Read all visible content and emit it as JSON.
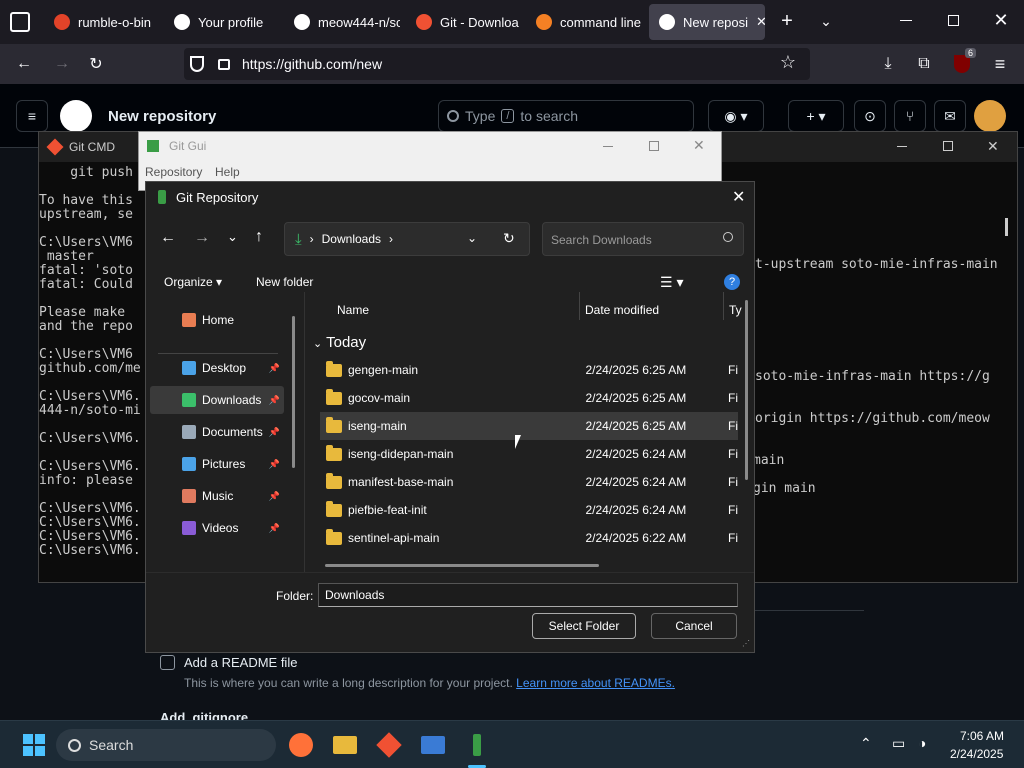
{
  "browser": {
    "tabs": [
      {
        "label": "rumble-o-bin",
        "icon": "gitlab-icon",
        "color": "#e24329"
      },
      {
        "label": "Your profile",
        "icon": "github-icon",
        "color": "#ffffff"
      },
      {
        "label": "meow444-n/sc",
        "icon": "github-icon",
        "color": "#ffffff"
      },
      {
        "label": "Git - Downloa",
        "icon": "git-icon",
        "color": "#f05133"
      },
      {
        "label": "command line",
        "icon": "stackoverflow-icon",
        "color": "#f48024"
      },
      {
        "label": "New reposi",
        "icon": "github-icon",
        "color": "#ffffff"
      }
    ],
    "url": "https://github.com/new",
    "extension_badge": "6"
  },
  "github": {
    "page_title": "New repository",
    "search_prefix": "Type",
    "search_key": "/",
    "search_suffix": "to search",
    "readme_label": "Add a README file",
    "readme_desc": "This is where you can write a long description for your project.",
    "readme_link": "Learn more about READMEs.",
    "gitignore_label": "Add .gitignore"
  },
  "cmd": {
    "title": "Git CMD",
    "lines": [
      "    git push",
      "",
      "To have this",
      "upstream, se",
      "",
      "C:\\Users\\VM6",
      " master",
      "fatal: 'soto",
      "fatal: Could",
      "",
      "Please make",
      "and the repo",
      "",
      "C:\\Users\\VM6",
      "github.com/me",
      "",
      "C:\\Users\\VM6.",
      "444-n/soto-mi",
      "",
      "C:\\Users\\VM6.",
      "",
      "C:\\Users\\VM6.",
      "info: please",
      "",
      "C:\\Users\\VM6.",
      "C:\\Users\\VM6.",
      "C:\\Users\\VM6.",
      "C:\\Users\\VM6."
    ],
    "right_lines": [
      {
        "text": "t-upstream soto-mie-infras-main",
        "row": 8
      },
      {
        "text": "soto-mie-infras-main https://g",
        "row": 11
      },
      {
        "text": "origin https://github.com/meow",
        "row": 14
      },
      {
        "text": "main",
        "row": 17
      },
      {
        "text": "gin main",
        "row": 19
      }
    ]
  },
  "gitgui": {
    "title": "Git Gui",
    "menu": [
      "Repository",
      "Help"
    ]
  },
  "dialog": {
    "title": "Git Repository",
    "breadcrumb": "Downloads",
    "search_placeholder": "Search Downloads",
    "organize": "Organize",
    "new_folder": "New folder",
    "sidebar": [
      {
        "label": "Home",
        "icon": "home-icon",
        "pin": false
      },
      {
        "label": "Desktop",
        "icon": "desktop-icon",
        "pin": true
      },
      {
        "label": "Downloads",
        "icon": "download-icon",
        "pin": true,
        "selected": true
      },
      {
        "label": "Documents",
        "icon": "documents-icon",
        "pin": true
      },
      {
        "label": "Pictures",
        "icon": "pictures-icon",
        "pin": true
      },
      {
        "label": "Music",
        "icon": "music-icon",
        "pin": true
      },
      {
        "label": "Videos",
        "icon": "videos-icon",
        "pin": true
      }
    ],
    "columns": {
      "name": "Name",
      "date": "Date modified",
      "type": "Ty"
    },
    "group": "Today",
    "files": [
      {
        "name": "gengen-main",
        "date": "2/24/2025 6:25 AM",
        "type": "Fi"
      },
      {
        "name": "gocov-main",
        "date": "2/24/2025 6:25 AM",
        "type": "Fi"
      },
      {
        "name": "iseng-main",
        "date": "2/24/2025 6:25 AM",
        "type": "Fi",
        "hover": true
      },
      {
        "name": "iseng-didepan-main",
        "date": "2/24/2025 6:24 AM",
        "type": "Fi"
      },
      {
        "name": "manifest-base-main",
        "date": "2/24/2025 6:24 AM",
        "type": "Fi"
      },
      {
        "name": "piefbie-feat-init",
        "date": "2/24/2025 6:24 AM",
        "type": "Fi"
      },
      {
        "name": "sentinel-api-main",
        "date": "2/24/2025 6:22 AM",
        "type": "Fi"
      }
    ],
    "folder_label": "Folder:",
    "folder_value": "Downloads",
    "select_button": "Select Folder",
    "cancel_button": "Cancel"
  },
  "taskbar": {
    "search": "Search",
    "time": "7:06 AM",
    "date": "2/24/2025"
  }
}
